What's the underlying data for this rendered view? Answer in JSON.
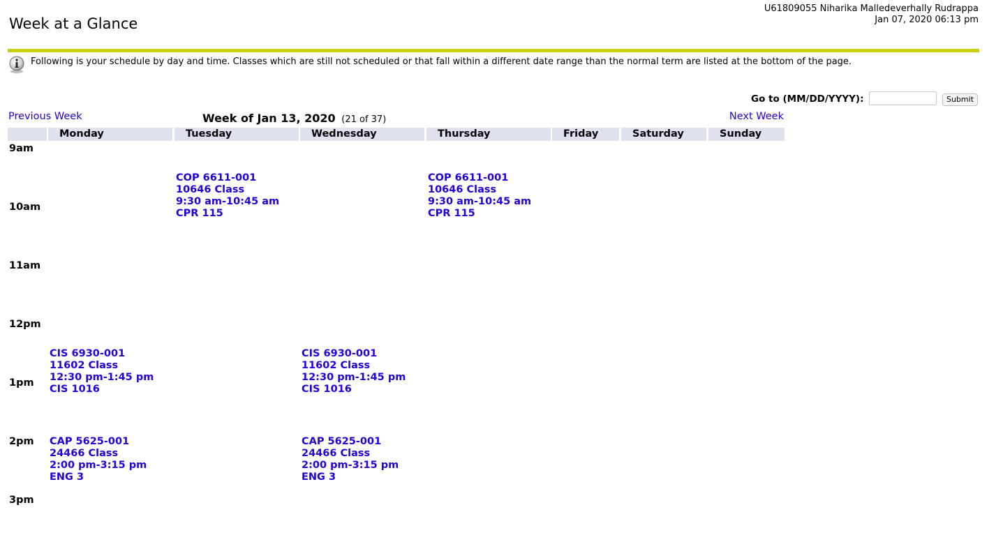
{
  "header": {
    "title": "Week at a Glance",
    "user": "U61809055 Niharika Malledeverhally Rudrappa",
    "timestamp": "Jan 07, 2020 06:13 pm",
    "rule_color": "#cbcd0a"
  },
  "info": {
    "icon": "info-icon",
    "text": "Following is your schedule by day and time. Classes which are still not scheduled or that fall within a different date range than the normal term are listed at the bottom of the page."
  },
  "goto": {
    "label": "Go to (MM/DD/YYYY):",
    "value": "",
    "submit_label": "Submit"
  },
  "nav": {
    "prev_label": "Previous Week",
    "next_label": "Next Week",
    "week_label": "Week of Jan 13, 2020",
    "week_count": "(21 of 37)",
    "link_color": "#2200dd"
  },
  "days": [
    "Monday",
    "Tuesday",
    "Wednesday",
    "Thursday",
    "Friday",
    "Saturday",
    "Sunday"
  ],
  "header_bg": "#dfe2ec",
  "times": [
    "9am",
    "10am",
    "11am",
    "12pm",
    "1pm",
    "2pm",
    "3pm"
  ],
  "events": [
    {
      "day": "Tuesday",
      "course": "COP 6611-001",
      "crn": "10646 Class",
      "time": "9:30 am-10:45 am",
      "room": "CPR 115"
    },
    {
      "day": "Thursday",
      "course": "COP 6611-001",
      "crn": "10646 Class",
      "time": "9:30 am-10:45 am",
      "room": "CPR 115"
    },
    {
      "day": "Monday",
      "course": "CIS 6930-001",
      "crn": "11602 Class",
      "time": "12:30 pm-1:45 pm",
      "room": "CIS 1016"
    },
    {
      "day": "Wednesday",
      "course": "CIS 6930-001",
      "crn": "11602 Class",
      "time": "12:30 pm-1:45 pm",
      "room": "CIS 1016"
    },
    {
      "day": "Monday",
      "course": "CAP 5625-001",
      "crn": "24466 Class",
      "time": "2:00 pm-3:15 pm",
      "room": "ENG 3"
    },
    {
      "day": "Wednesday",
      "course": "CAP 5625-001",
      "crn": "24466 Class",
      "time": "2:00 pm-3:15 pm",
      "room": "ENG 3"
    }
  ]
}
